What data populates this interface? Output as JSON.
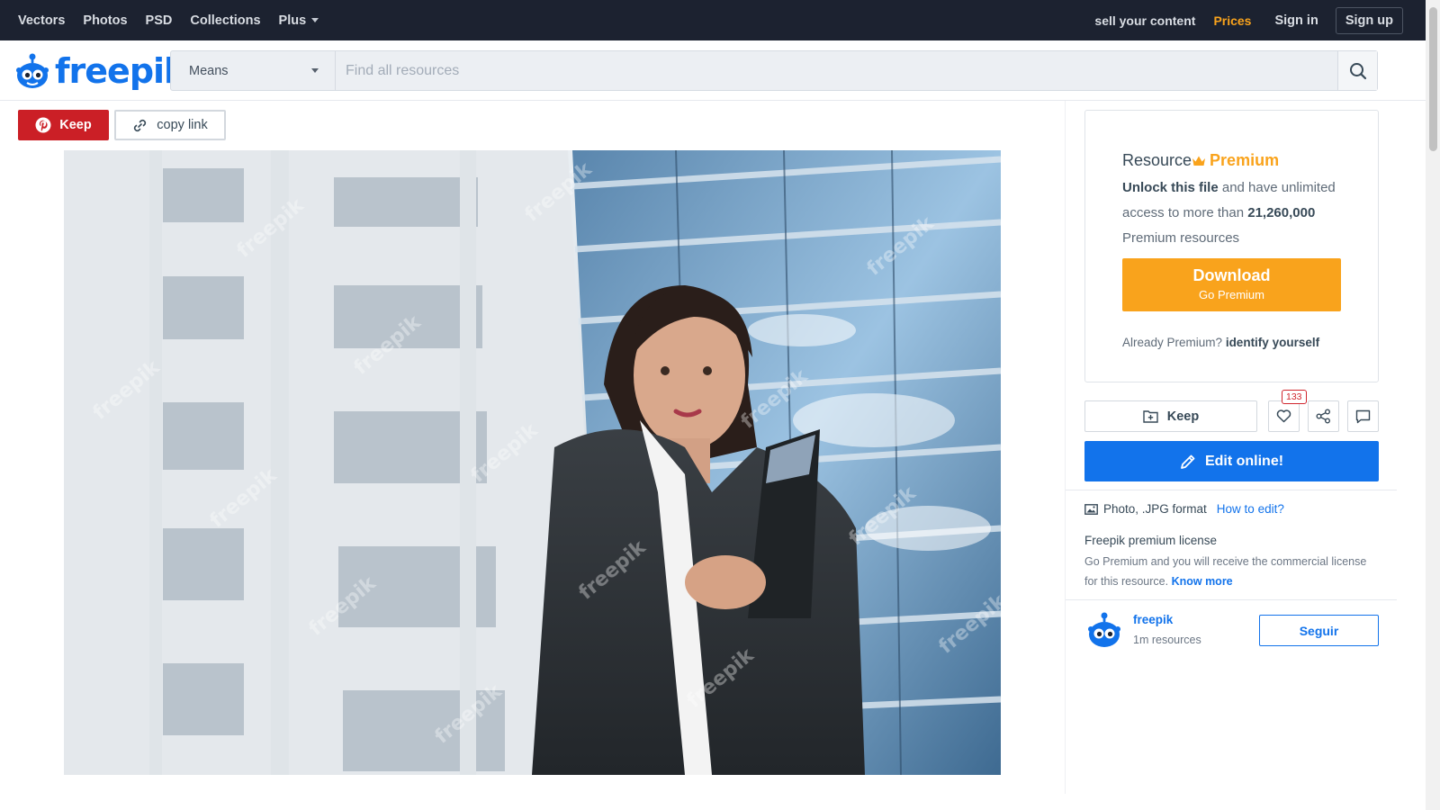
{
  "topnav": {
    "links": [
      "Vectors",
      "Photos",
      "PSD",
      "Collections",
      "Plus"
    ],
    "sell": "sell your content",
    "prices": "Prices",
    "signin": "Sign in",
    "signup": "Sign up"
  },
  "header": {
    "logo": "freepik",
    "means": "Means",
    "search_placeholder": "Find all resources"
  },
  "share": {
    "keep": "Keep",
    "copy": "copy link"
  },
  "premium": {
    "resource": "Resource",
    "premium": "Premium",
    "unlock": "Unlock this file",
    "desc1": " and have unlimited access to more than ",
    "count": "21,260,000",
    "desc2": " Premium resources",
    "download": "Download",
    "go_premium": "Go Premium",
    "already": "Already Premium?",
    "identify": "identify yourself"
  },
  "actions": {
    "keep": "Keep",
    "likes": "133",
    "edit": "Edit online!"
  },
  "info": {
    "format": "Photo, .JPG format",
    "how": "How to edit?",
    "license_title": "Freepik premium license",
    "license_text": "Go Premium and you will receive the commercial license for this resource.",
    "know_more": "Know more"
  },
  "author": {
    "name": "freepik",
    "resources": "1m resources",
    "follow": "Seguir"
  },
  "colors": {
    "brand": "#1273eb",
    "premium": "#f9a31c",
    "pinterest": "#cb1f26"
  }
}
